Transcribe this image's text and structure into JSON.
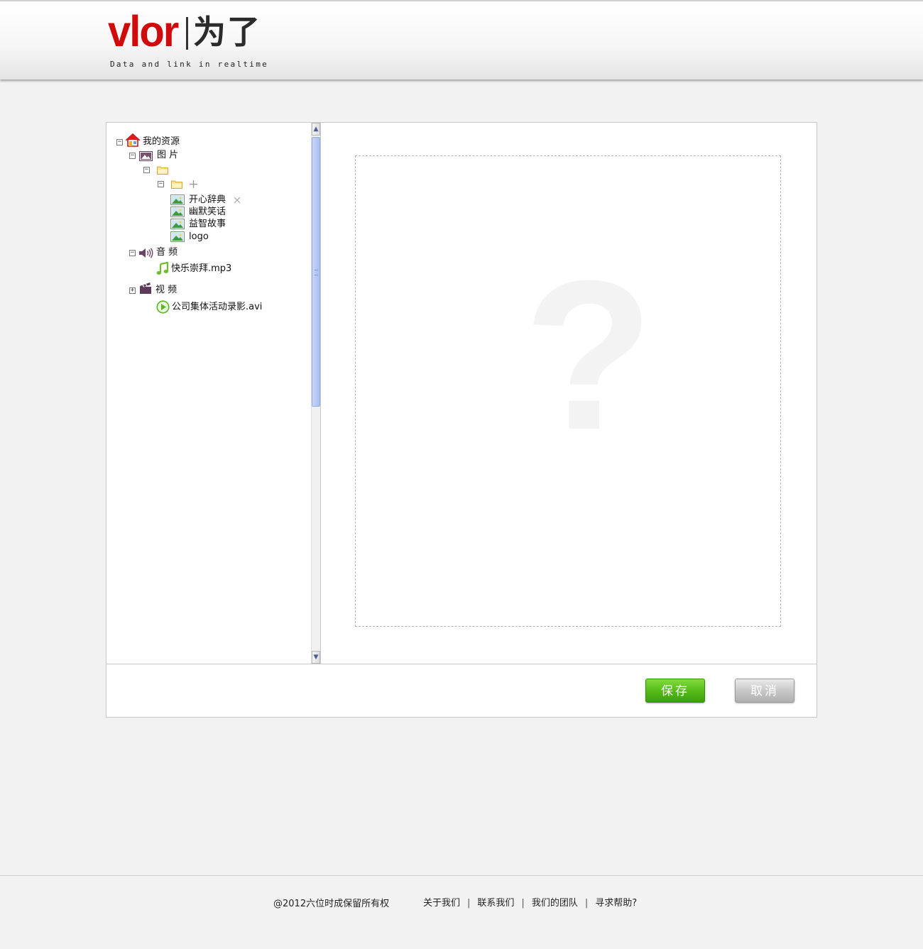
{
  "header": {
    "brand": "vlor",
    "brand_cn": "为了",
    "tagline": "Data and link in realtime"
  },
  "tree": {
    "root": {
      "label": "我的资源"
    },
    "images": {
      "label": "图 片",
      "items": [
        "开心辞典",
        "幽默笑话",
        "益智故事",
        "logo"
      ]
    },
    "audio": {
      "label": "音 频",
      "items": [
        "快乐崇拜.mp3"
      ]
    },
    "video": {
      "label": "视 频",
      "items": [
        "公司集体活动录影.avi"
      ]
    }
  },
  "preview": {
    "placeholder": "?"
  },
  "actions": {
    "save": "保存",
    "cancel": "取消"
  },
  "footer": {
    "copyright": "@2012六位时成保留所有权",
    "links": [
      "关于我们",
      "联系我们",
      "我们的团队",
      "寻求帮助?"
    ]
  },
  "colors": {
    "brand_red": "#d00b0b",
    "save_green": "#55bd1a",
    "cancel_gray": "#c8c8c8"
  }
}
